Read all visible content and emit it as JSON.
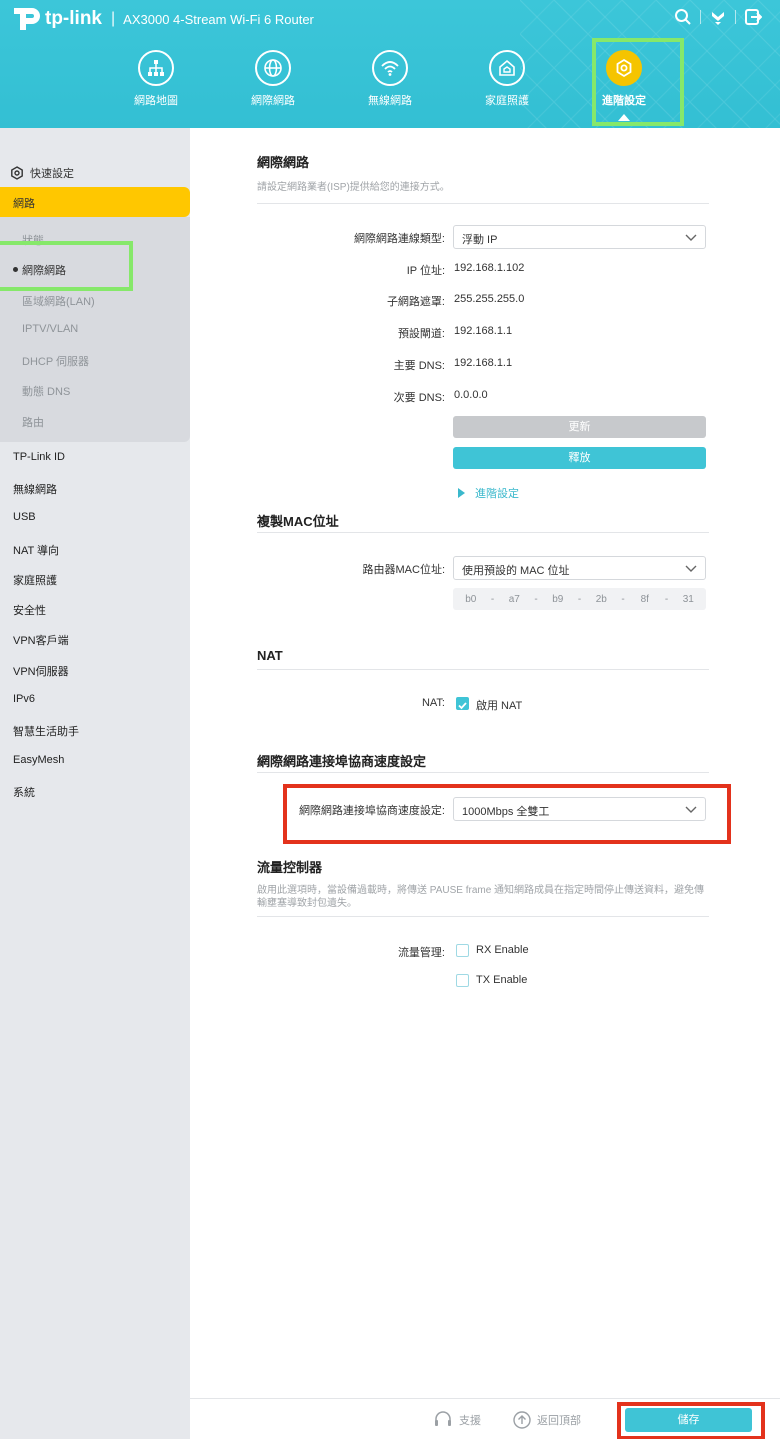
{
  "header": {
    "brand": "tp-link",
    "model": "AX3000 4-Stream Wi-Fi 6 Router",
    "icons": [
      "search-icon",
      "download-icon",
      "logout-icon"
    ],
    "nav": [
      {
        "label": "網路地圖",
        "icon": "network-map-icon"
      },
      {
        "label": "網際網路",
        "icon": "globe-icon"
      },
      {
        "label": "無線網路",
        "icon": "wifi-icon"
      },
      {
        "label": "家庭照護",
        "icon": "home-care-icon"
      },
      {
        "label": "進階設定",
        "icon": "gear-icon",
        "active": true
      }
    ]
  },
  "sidebar": {
    "quick_setup": "快速設定",
    "active_section": "網路",
    "sub_items": [
      "狀態",
      "網際網路",
      "區域網路(LAN)",
      "IPTV/VLAN",
      "DHCP 伺服器",
      "動態 DNS",
      "路由"
    ],
    "current_sub": "網際網路",
    "items": [
      "TP-Link ID",
      "無線網路",
      "USB",
      "NAT 導向",
      "家庭照護",
      "安全性",
      "VPN客戶端",
      "VPN伺服器",
      "IPv6",
      "智慧生活助手",
      "EasyMesh",
      "系統"
    ]
  },
  "internet": {
    "title": "網際網路",
    "description": "請設定網路業者(ISP)提供給您的連接方式。",
    "conn_type_label": "網際網路連線類型:",
    "conn_type_value": "浮動 IP",
    "ip_label": "IP 位址:",
    "ip_value": "192.168.1.102",
    "mask_label": "子網路遮罩:",
    "mask_value": "255.255.255.0",
    "gateway_label": "預設閘道:",
    "gateway_value": "192.168.1.1",
    "dns1_label": "主要 DNS:",
    "dns1_value": "192.168.1.1",
    "dns2_label": "次要 DNS:",
    "dns2_value": "0.0.0.0",
    "renew_label": "更新",
    "release_label": "釋放",
    "advanced_label": "進階設定"
  },
  "mac": {
    "title": "複製MAC位址",
    "router_mac_label": "路由器MAC位址:",
    "router_mac_value": "使用預設的 MAC 位址",
    "octets": [
      "b0",
      "a7",
      "b9",
      "2b",
      "8f",
      "31"
    ]
  },
  "nat": {
    "title": "NAT",
    "label": "NAT:",
    "enable_label": "啟用 NAT",
    "enabled": true
  },
  "speed": {
    "title": "網際網路連接埠協商速度設定",
    "label": "網際網路連接埠協商速度設定:",
    "value": "1000Mbps 全雙工"
  },
  "flow": {
    "title": "流量控制器",
    "description": "啟用此選項時，當設備過載時，將傳送 PAUSE frame 通知網路成員在指定時間停止傳送資料，避免傳輸壅塞導致封包遺失。",
    "label": "流量管理:",
    "rx_label": "RX Enable",
    "tx_label": "TX Enable",
    "rx_enabled": false,
    "tx_enabled": false
  },
  "footer": {
    "support_label": "支援",
    "back_to_top_label": "返回頂部",
    "save_label": "儲存"
  },
  "colors": {
    "header": "#3cc6d9",
    "accent": "#3fc4d6",
    "active_yellow": "#ffc700",
    "highlight_green": "#86e86a",
    "highlight_red": "#e3321c"
  }
}
